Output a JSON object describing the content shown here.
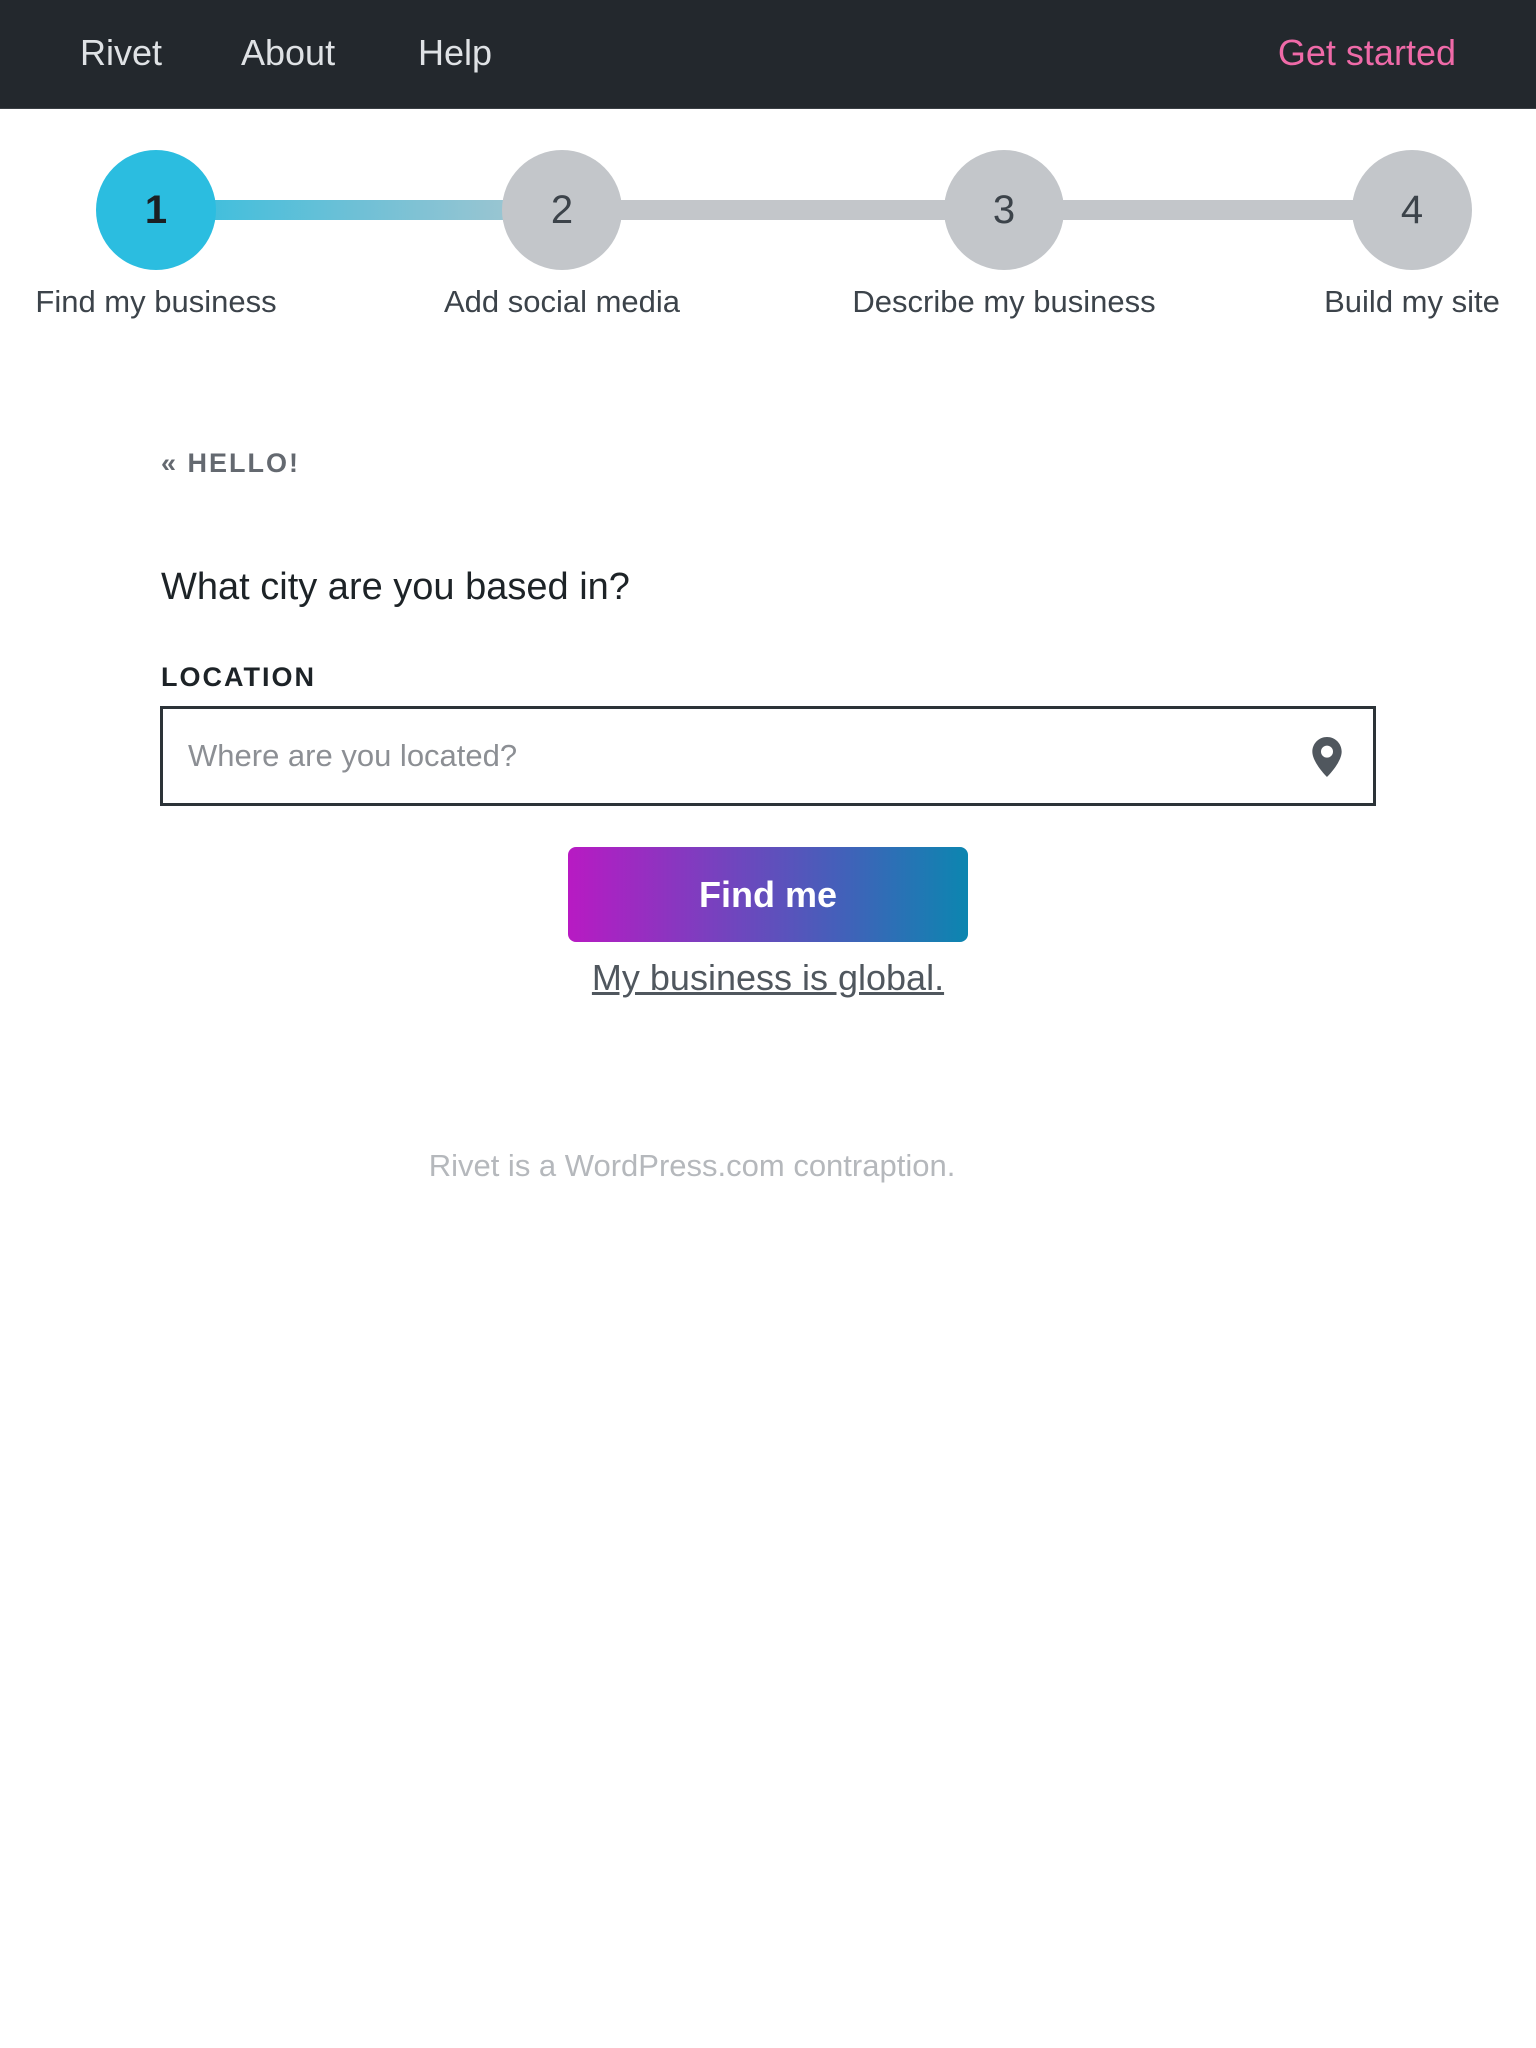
{
  "nav": {
    "brand": "Rivet",
    "about": "About",
    "help": "Help",
    "cta": "Get started"
  },
  "stepper": {
    "current_step": 1,
    "steps": [
      {
        "number": "1",
        "label": "Find my business"
      },
      {
        "number": "2",
        "label": "Add social media"
      },
      {
        "number": "3",
        "label": "Describe my business"
      },
      {
        "number": "4",
        "label": "Build my site"
      }
    ]
  },
  "main": {
    "back_link": "« HELLO!",
    "question": "What city are you based in?",
    "location_label": "LOCATION",
    "location_value": "",
    "location_placeholder": "Where are you located?",
    "location_icon": "map-pin-icon",
    "find_button": "Find me",
    "global_link": "My business is global."
  },
  "footer": {
    "note": "Rivet is a WordPress.com contraption."
  },
  "colors": {
    "topbar_bg": "#23282d",
    "cta_pink": "#ef6aa8",
    "active_step": "#2bbde0",
    "inactive_step": "#c3c6ca",
    "button_gradient_start": "#b81ac3",
    "button_gradient_end": "#0c86b0"
  }
}
